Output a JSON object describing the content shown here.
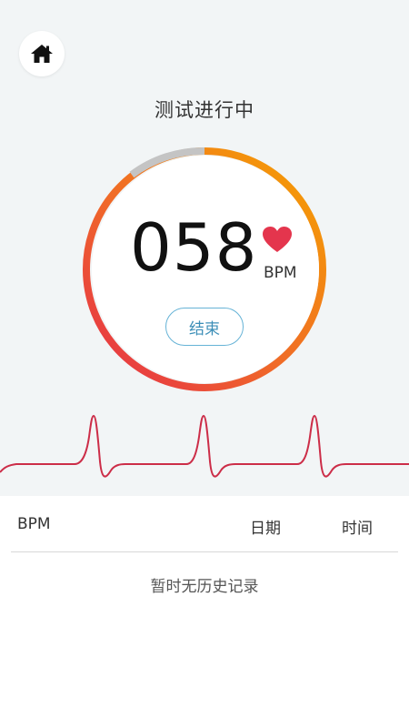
{
  "header": {
    "home_icon": "home-icon"
  },
  "measurement": {
    "status": "测试进行中",
    "bpm_value": "058",
    "bpm_unit": "BPM",
    "heart_icon": "heart-icon",
    "end_button_label": "结束",
    "colors": {
      "gauge_start": "#f5a300",
      "gauge_end": "#e52d4a",
      "gauge_track": "#c4c4c4",
      "heart": "#e4354d",
      "ecg_line": "#cc2d48"
    }
  },
  "history": {
    "columns": [
      "BPM",
      "日期",
      "时间"
    ],
    "empty_message": "暂时无历史记录"
  }
}
